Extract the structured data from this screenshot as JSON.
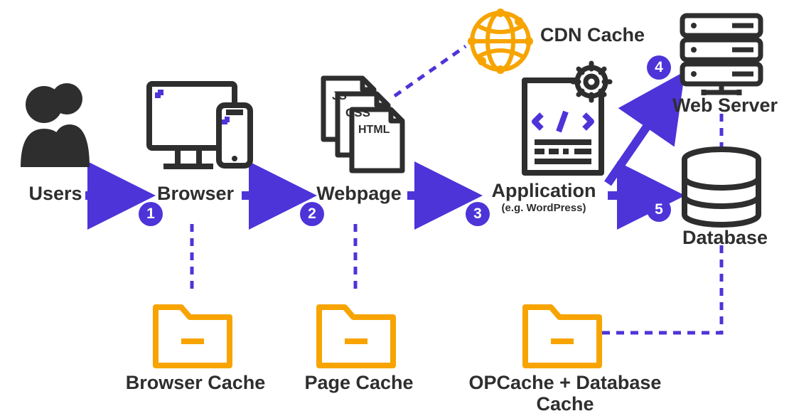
{
  "nodes": {
    "users": "Users",
    "browser": "Browser",
    "webpage": "Webpage",
    "application": "Application",
    "application_sub": "(e.g. WordPress)",
    "cdn_cache": "CDN Cache",
    "web_server": "Web Server",
    "database": "Database",
    "browser_cache": "Browser Cache",
    "page_cache": "Page Cache",
    "op_db_cache": "OPCache + Database Cache"
  },
  "steps": [
    "1",
    "2",
    "3",
    "4",
    "5"
  ],
  "file_labels": {
    "js": "JS",
    "css": "CSS",
    "html": "HTML"
  },
  "colors": {
    "purple": "#4d34d8",
    "orange": "#f7a400",
    "dark": "#2e2e2e"
  }
}
